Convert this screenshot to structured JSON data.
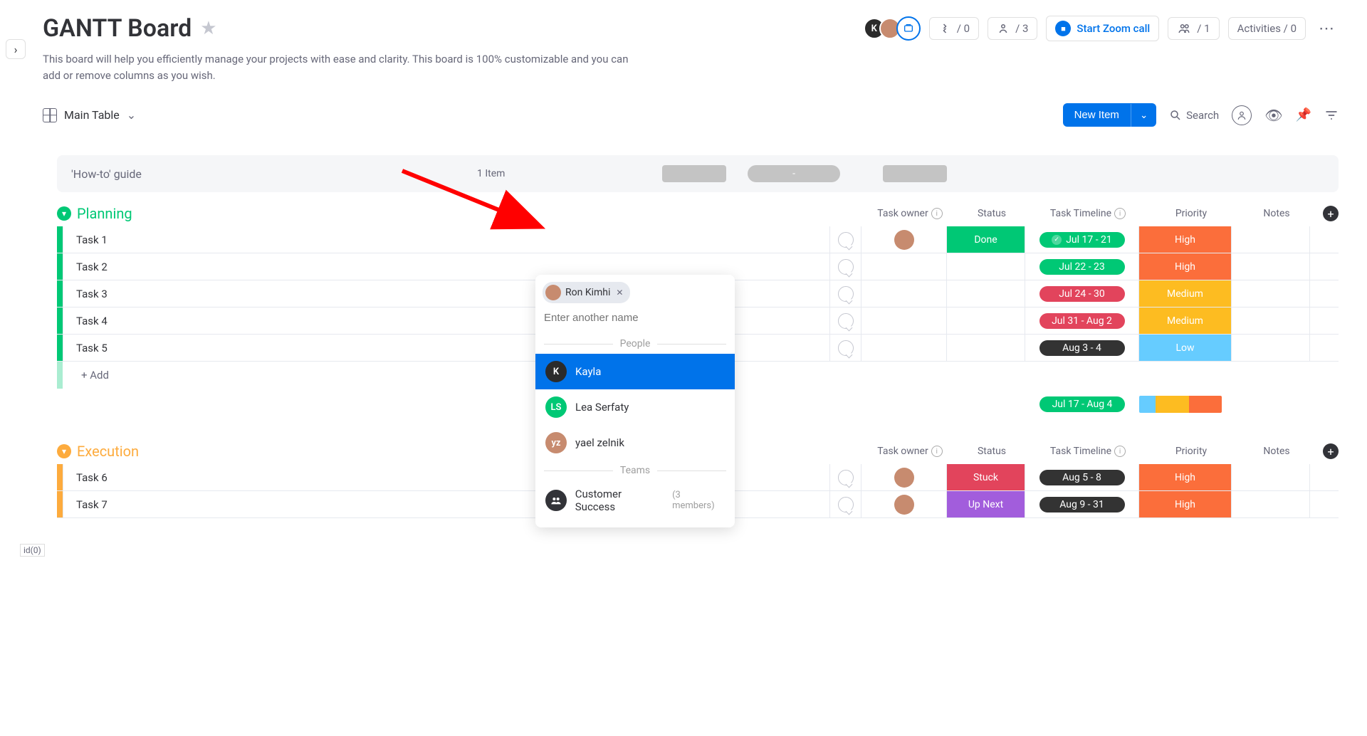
{
  "header": {
    "title": "GANTT Board",
    "description": "This board will help you efficiently manage your projects with ease and clarity. This board is 100% customizable and you can add or remove columns as you wish.",
    "integrations": {
      "left_count": "/ 0",
      "right_count": "/ 3"
    },
    "zoom_label": "Start Zoom call",
    "members_label": "/ 1",
    "activities_label": "Activities / 0"
  },
  "toolbar": {
    "view_label": "Main Table",
    "new_item_label": "New Item",
    "search_label": "Search"
  },
  "howto": {
    "title": "'How-to' guide",
    "count": "1 Item",
    "dash": "-"
  },
  "columns": {
    "owner": "Task owner",
    "status": "Status",
    "timeline": "Task Timeline",
    "priority": "Priority",
    "notes": "Notes"
  },
  "groups": [
    {
      "name": "Planning",
      "color": "#00c875",
      "summary_timeline": "Jul 17 - Aug 4",
      "rows": [
        {
          "name": "Task 1",
          "owner_avatar": "rk",
          "status": "Done",
          "status_color": "#00c875",
          "timeline": "Jul 17 - 21",
          "timeline_color": "#00c875",
          "timeline_check": true,
          "priority": "High",
          "priority_color": "#fb6e3b"
        },
        {
          "name": "Task 2",
          "owner_avatar": "",
          "status": "",
          "status_color": "",
          "timeline": "Jul 22 - 23",
          "timeline_color": "#00c875",
          "timeline_check": false,
          "priority": "High",
          "priority_color": "#fb6e3b"
        },
        {
          "name": "Task 3",
          "owner_avatar": "",
          "status": "",
          "status_color": "",
          "timeline": "Jul 24 - 30",
          "timeline_color": "#e2445c",
          "timeline_check": false,
          "priority": "Medium",
          "priority_color": "#fdbc21"
        },
        {
          "name": "Task 4",
          "owner_avatar": "",
          "status": "",
          "status_color": "",
          "timeline": "Jul 31 - Aug 2",
          "timeline_color": "#e2445c",
          "timeline_check": false,
          "priority": "Medium",
          "priority_color": "#fdbc21"
        },
        {
          "name": "Task 5",
          "owner_avatar": "",
          "status": "",
          "status_color": "",
          "timeline": "Aug 3 - 4",
          "timeline_color": "#333333",
          "timeline_check": false,
          "priority": "Low",
          "priority_color": "#66ccff"
        }
      ],
      "add_label": "+ Add",
      "priority_summary": [
        {
          "color": "#66ccff",
          "pct": 20
        },
        {
          "color": "#fdbc21",
          "pct": 40
        },
        {
          "color": "#fb6e3b",
          "pct": 40
        }
      ]
    },
    {
      "name": "Execution",
      "color": "#fdab3d",
      "rows": [
        {
          "name": "Task 6",
          "owner_avatar": "yz",
          "status": "Stuck",
          "status_color": "#e2445c",
          "timeline": "Aug 5 - 8",
          "timeline_color": "#333333",
          "timeline_check": false,
          "priority": "High",
          "priority_color": "#fb6e3b"
        },
        {
          "name": "Task 7",
          "owner_avatar": "ls",
          "status": "Up Next",
          "status_color": "#a25ddc",
          "timeline": "Aug 9 - 31",
          "timeline_color": "#333333",
          "timeline_check": false,
          "priority": "High",
          "priority_color": "#fb6e3b"
        }
      ]
    }
  ],
  "popup": {
    "selected_chip": "Ron Kimhi",
    "placeholder": "Enter another name",
    "people_heading": "People",
    "teams_heading": "Teams",
    "people": [
      {
        "initials": "K",
        "name": "Kayla",
        "color": "#2b2b2b",
        "selected": true
      },
      {
        "initials": "LS",
        "name": "Lea Serfaty",
        "color": "#00c875",
        "selected": false
      },
      {
        "initials": "yz",
        "name": "yael zelnik",
        "color": "#c78b6f",
        "selected": false
      }
    ],
    "team": {
      "name": "Customer Success",
      "members": "(3 members)"
    }
  },
  "status_label_id": "id(0)"
}
